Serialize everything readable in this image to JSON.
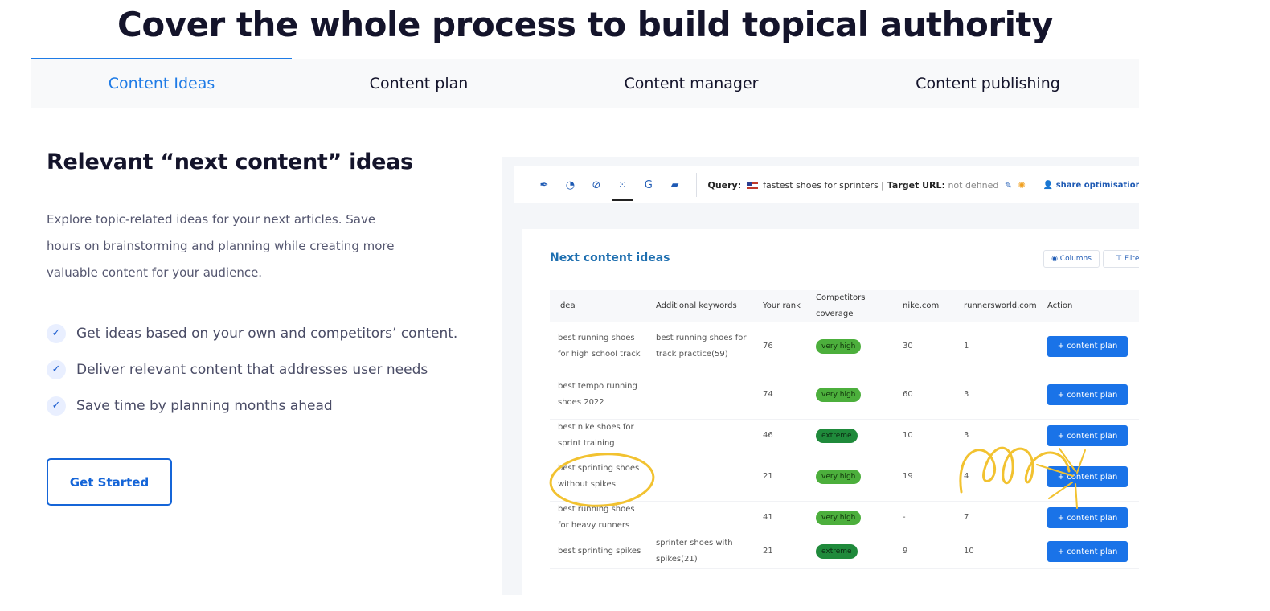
{
  "hero": {
    "title": "Cover the whole process to build topical authority"
  },
  "tabs": [
    {
      "label": "Content Ideas",
      "active": true
    },
    {
      "label": "Content plan",
      "active": false
    },
    {
      "label": "Content manager",
      "active": false
    },
    {
      "label": "Content publishing",
      "active": false
    }
  ],
  "section": {
    "title": "Relevant “next content” ideas",
    "description": "Explore topic-related ideas for your next articles. Save hours on brainstorming and planning while creating more valuable content for your audience.",
    "bullets": [
      "Get ideas based on your own and competitors’ content.",
      "Deliver relevant content that addresses user needs",
      "Save time by planning months ahead"
    ],
    "cta_label": "Get Started"
  },
  "screenshot": {
    "toolbar": {
      "icons": [
        "leaf-icon",
        "pie-chart-icon",
        "link-icon",
        "cluster-icon",
        "google-icon",
        "chat-icon"
      ],
      "query_label": "Query:",
      "query_value": "fastest shoes for sprinters",
      "separator": "|",
      "target_label": "Target URL:",
      "target_value": "not defined",
      "share_label": "share optimisation"
    },
    "card": {
      "title": "Next content ideas",
      "columns_btn": "Columns",
      "filters_btn": "Filters"
    },
    "table": {
      "headers": {
        "idea": "Idea",
        "additional": "Additional keywords",
        "rank": "Your rank",
        "coverage": "Competitors coverage",
        "nike": "nike.com",
        "runnersworld": "runnersworld.com",
        "action": "Action"
      },
      "action_label": "+ content plan",
      "rows": [
        {
          "idea": "best running shoes for high school track",
          "additional": "best running shoes for track practice(59)",
          "rank": "76",
          "coverage": "very high",
          "nike": "30",
          "runnersworld": "1"
        },
        {
          "idea": "best tempo running shoes 2022",
          "additional": "",
          "rank": "74",
          "coverage": "very high",
          "nike": "60",
          "runnersworld": "3"
        },
        {
          "idea": "best nike shoes for sprint training",
          "additional": "",
          "rank": "46",
          "coverage": "extreme",
          "nike": "10",
          "runnersworld": "3"
        },
        {
          "idea": "best sprinting shoes without spikes",
          "additional": "",
          "rank": "21",
          "coverage": "very high",
          "nike": "19",
          "runnersworld": "4"
        },
        {
          "idea": "best running shoes for heavy runners",
          "additional": "",
          "rank": "41",
          "coverage": "very high",
          "nike": "-",
          "runnersworld": "7"
        },
        {
          "idea": "best sprinting spikes",
          "additional": "sprinter shoes with spikes(21)",
          "rank": "21",
          "coverage": "extreme",
          "nike": "9",
          "runnersworld": "10"
        }
      ]
    },
    "colors": {
      "accent": "#1a73e8",
      "very_high": "#4caf3c",
      "extreme": "#1f8a3b",
      "highlight": "#f2c230"
    }
  }
}
